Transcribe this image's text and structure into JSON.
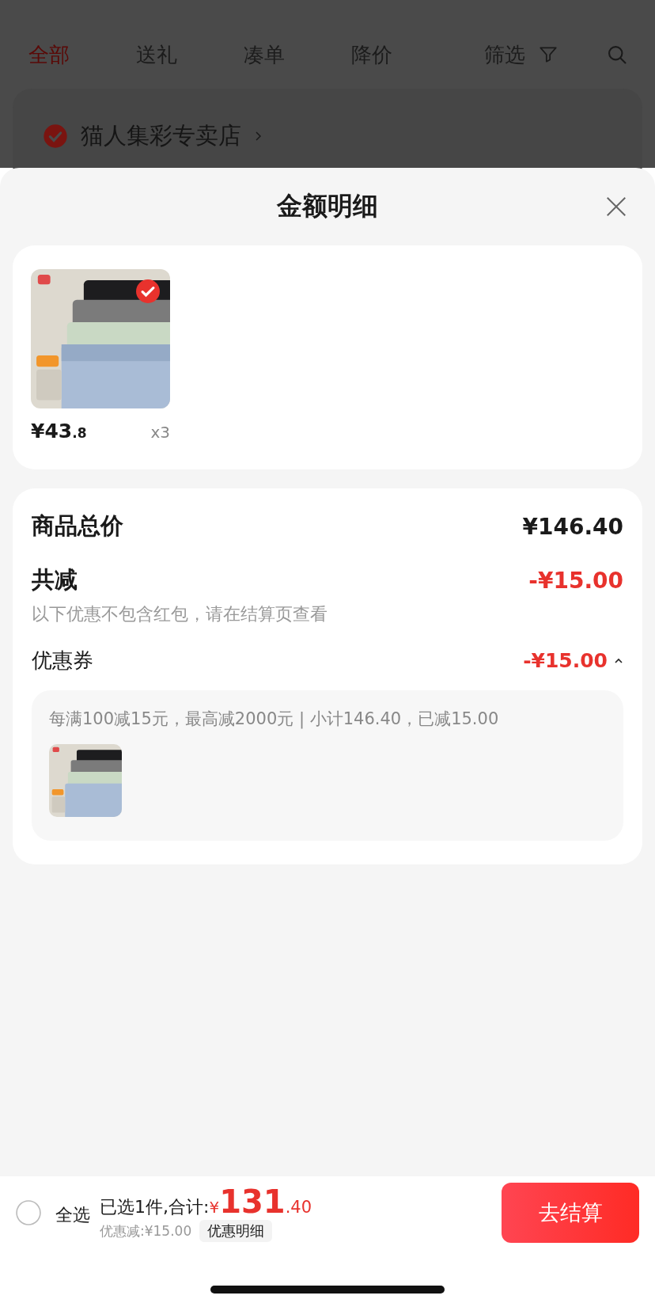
{
  "cart_tabs": [
    {
      "label": "全部",
      "selected": true
    },
    {
      "label": "送礼",
      "selected": false
    },
    {
      "label": "凑单",
      "selected": false
    },
    {
      "label": "降价",
      "selected": false
    }
  ],
  "filter": {
    "label": "筛选"
  },
  "store": {
    "name": "猫人集彩专卖店",
    "checked": true
  },
  "sheet": {
    "title": "金额明细"
  },
  "items": [
    {
      "price_main": "¥43",
      "price_decimal": ".8",
      "quantity": "x3",
      "selected": true
    }
  ],
  "summary": {
    "total_label": "商品总价",
    "total_value": "¥146.40",
    "discount_label": "共减",
    "discount_value": "-¥15.00",
    "note": "以下优惠不包含红包，请在结算页查看",
    "coupon_label": "优惠券",
    "coupon_value": "-¥15.00",
    "coupon_expanded": true,
    "coupon_rule": "每满100减15元，最高减2000元 | 小计146.40，已减15.00"
  },
  "footer": {
    "select_all_label": "全选",
    "select_all_checked": false,
    "selected_summary": "已选1件,合计:",
    "currency": "¥",
    "total_main": "131",
    "total_decimal": ".40",
    "saved": "优惠减:¥15.00",
    "detail_button": "优惠明细",
    "checkout": "去结算"
  }
}
